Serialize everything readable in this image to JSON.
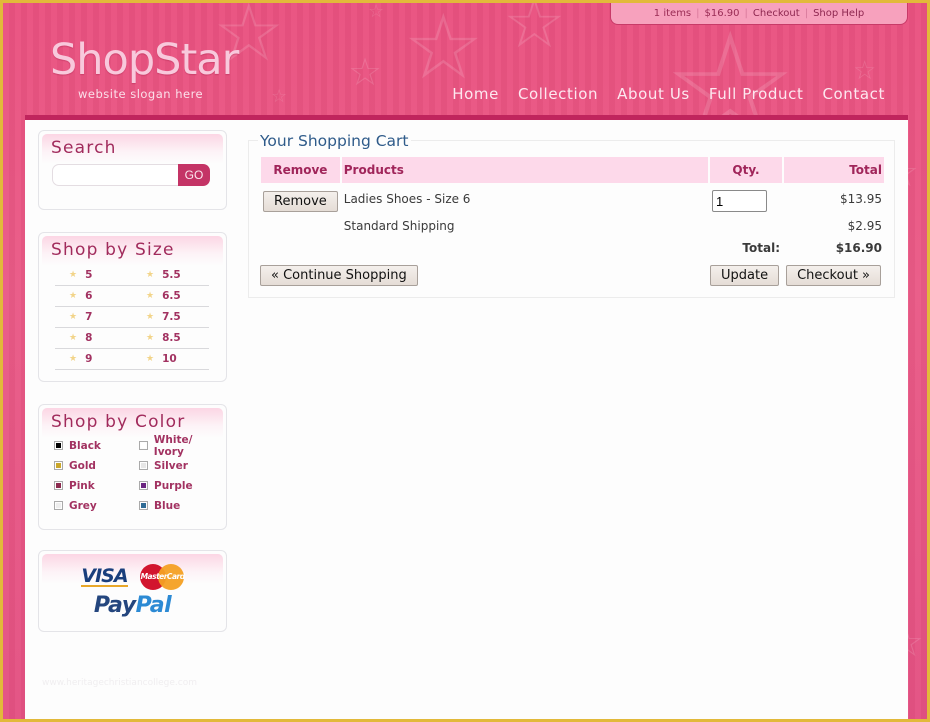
{
  "topbar": {
    "items_count": "1 items",
    "cart_total": "$16.90",
    "checkout_link": "Checkout",
    "help_link": "Shop Help"
  },
  "header": {
    "logo": "ShopStar",
    "slogan": "website slogan here",
    "nav": [
      "Home",
      "Collection",
      "About Us",
      "Full Product",
      "Contact"
    ]
  },
  "sidebar": {
    "search": {
      "title": "Search",
      "placeholder": "",
      "value": "",
      "button": "GO"
    },
    "size": {
      "title": "Shop by Size",
      "rows": [
        [
          "5",
          "5.5"
        ],
        [
          "6",
          "6.5"
        ],
        [
          "7",
          "7.5"
        ],
        [
          "8",
          "8.5"
        ],
        [
          "9",
          "10"
        ]
      ]
    },
    "color": {
      "title": "Shop by Color",
      "items": [
        {
          "label": "Black",
          "color": "#000000"
        },
        {
          "label": "White/ Ivory",
          "color": "#ffffff"
        },
        {
          "label": "Gold",
          "color": "#c9a62a"
        },
        {
          "label": "Silver",
          "color": "#e6e6e6"
        },
        {
          "label": "Pink",
          "color": "#8b2a4e"
        },
        {
          "label": "Purple",
          "color": "#6b2580"
        },
        {
          "label": "Grey",
          "color": "#eeeeee"
        },
        {
          "label": "Blue",
          "color": "#2f6b95"
        }
      ]
    },
    "payment": {
      "visa": "VISA",
      "mastercard": "MasterCard",
      "paypal_a": "Pay",
      "paypal_b": "Pal"
    },
    "watermark": "www.heritagechristiancollege.com"
  },
  "cart": {
    "title": "Your Shopping Cart",
    "headers": {
      "remove": "Remove",
      "products": "Products",
      "qty": "Qty.",
      "total": "Total"
    },
    "item": {
      "remove_button": "Remove",
      "product": "Ladies Shoes - Size 6",
      "qty": "1",
      "total": "$13.95"
    },
    "shipping": {
      "label": "Standard Shipping",
      "total": "$2.95"
    },
    "grand_total": {
      "label": "Total:",
      "value": "$16.90"
    },
    "buttons": {
      "continue": "« Continue Shopping",
      "update": "Update",
      "checkout": "Checkout »"
    }
  }
}
